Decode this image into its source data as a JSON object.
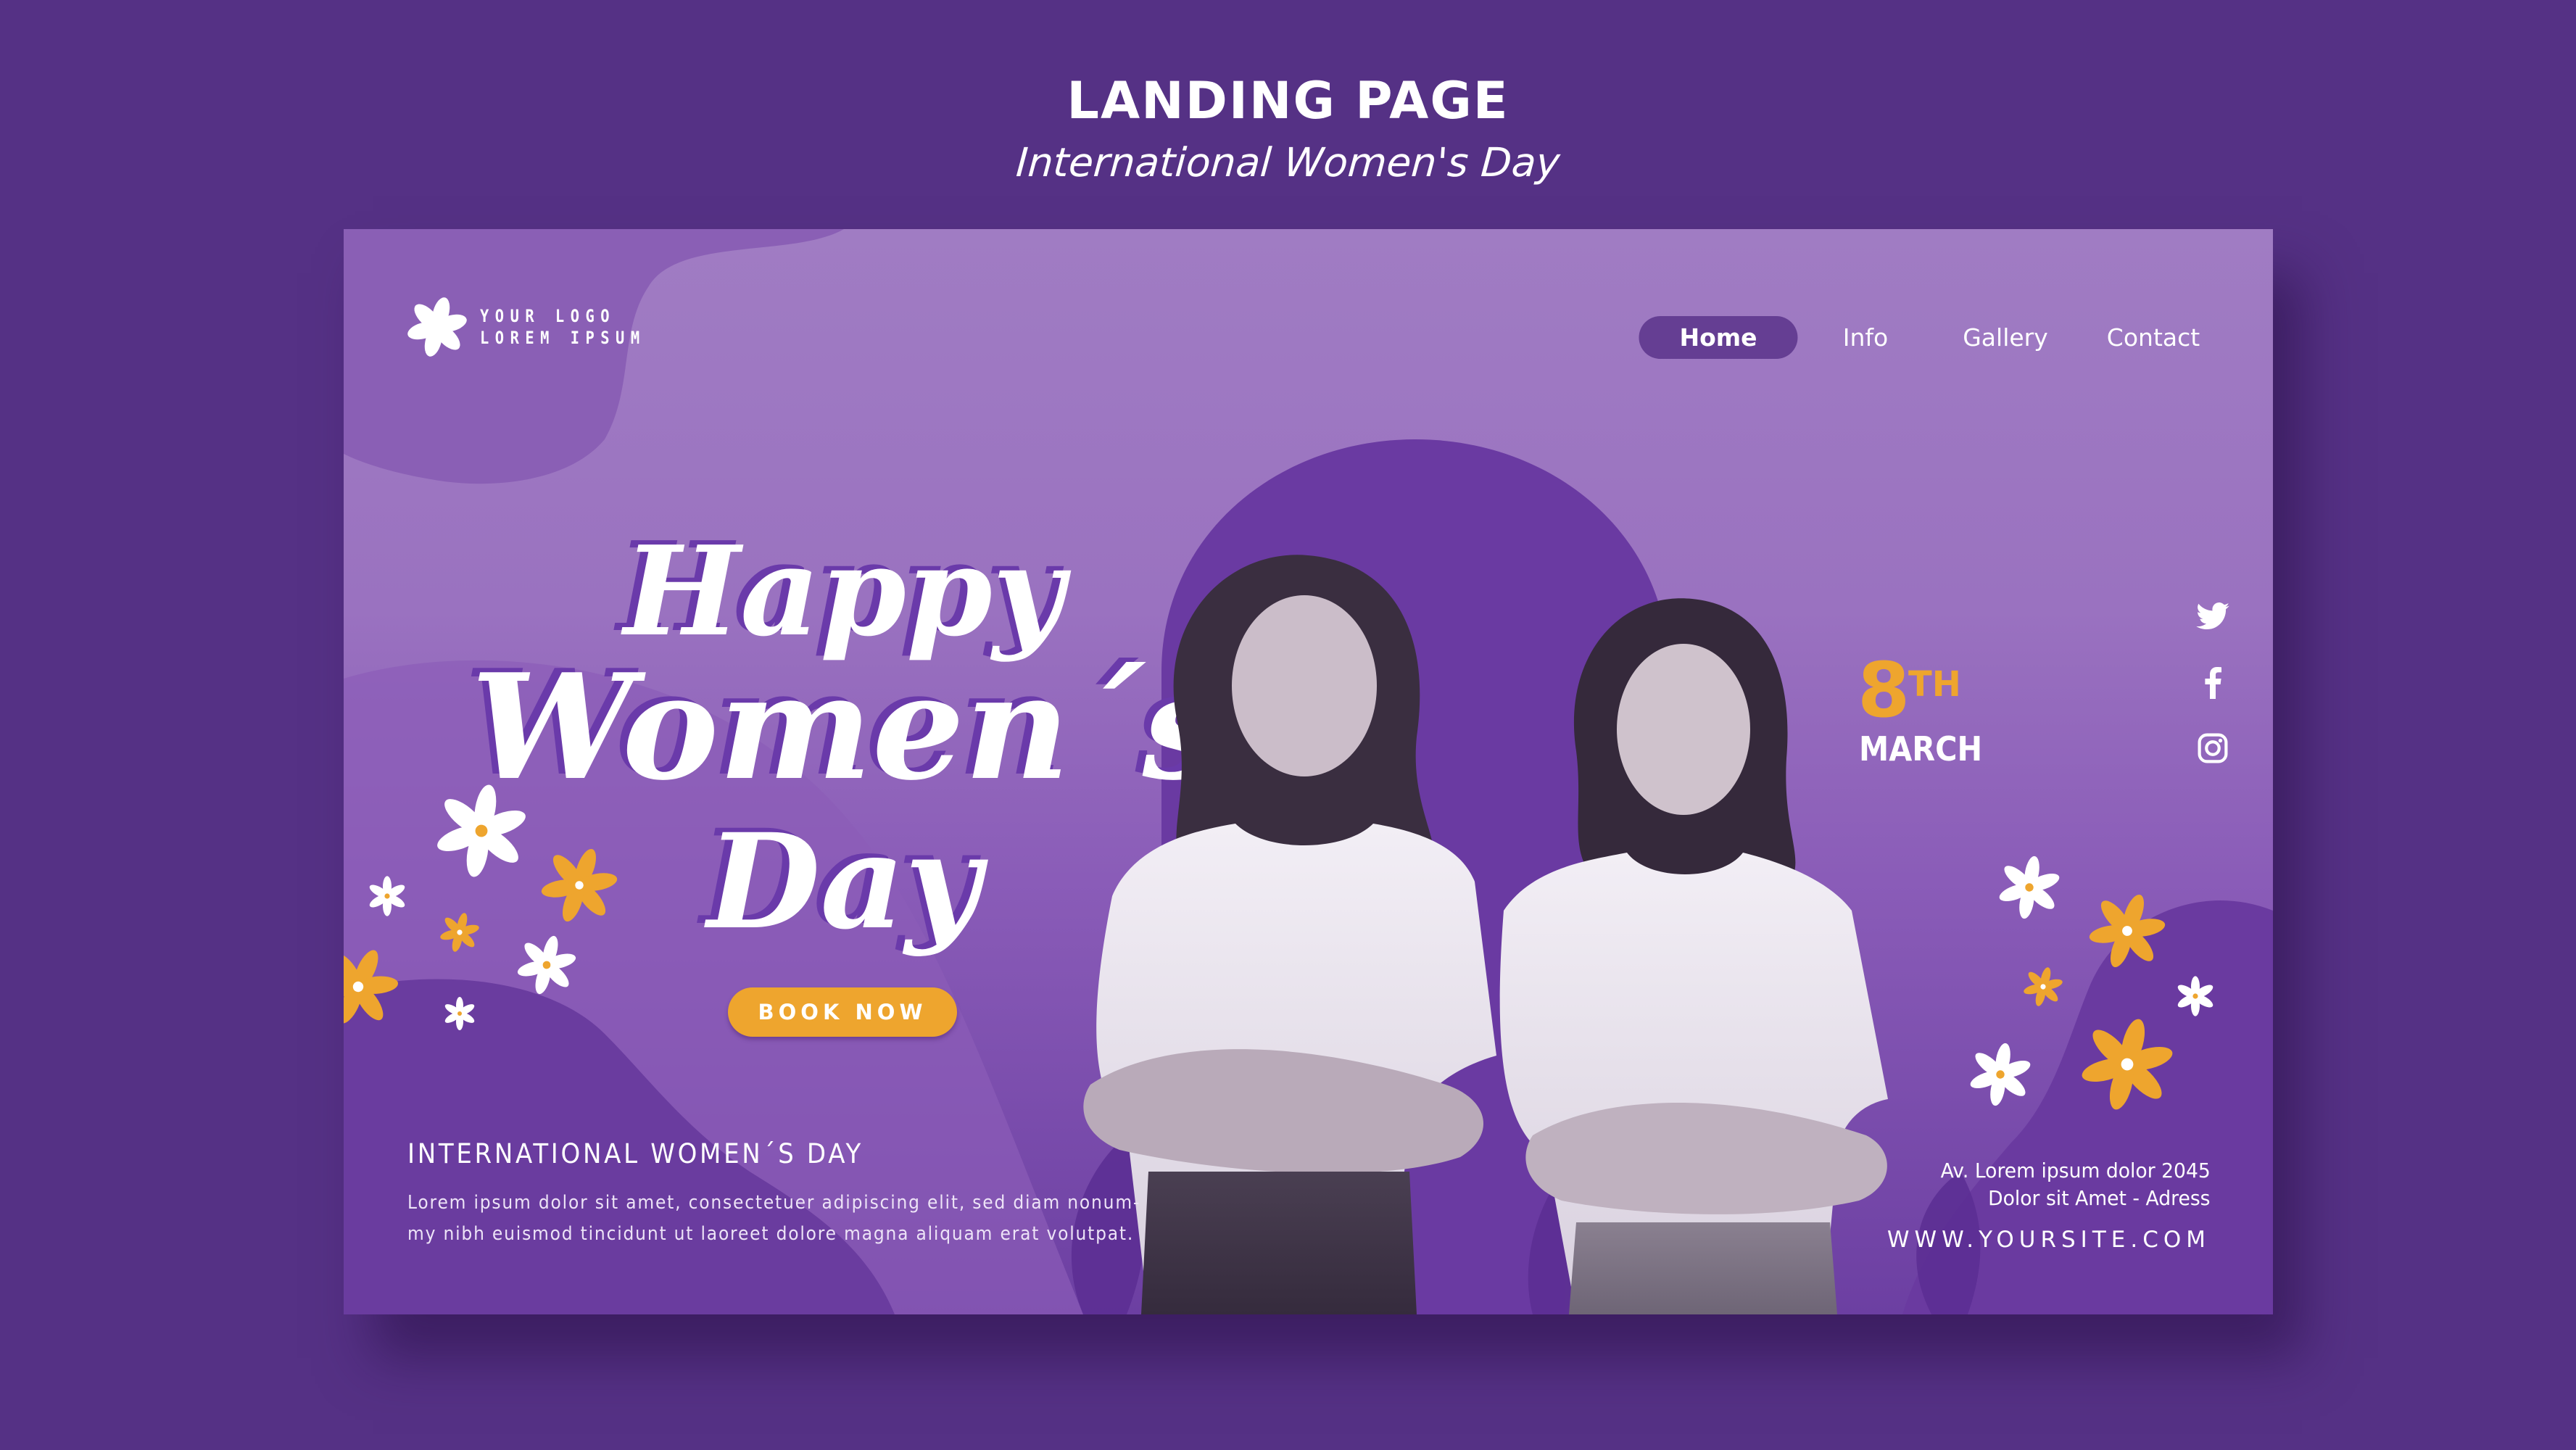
{
  "header": {
    "title": "LANDING PAGE",
    "subtitle": "International Women's Day"
  },
  "colors": {
    "page_background": "#553185",
    "card_top": "#a07cc3",
    "card_bottom": "#6c3fa2",
    "accent_orange": "#eea52e",
    "nav_active": "#653e93",
    "arch": "#6a3aa2"
  },
  "logo": {
    "icon": "flower-icon",
    "line1": "YOUR LOGO",
    "line2": "LOREM IPSUM"
  },
  "nav": {
    "items": [
      {
        "label": "Home",
        "active": true
      },
      {
        "label": "Info",
        "active": false
      },
      {
        "label": "Gallery",
        "active": false
      },
      {
        "label": "Contact",
        "active": false
      }
    ]
  },
  "hero": {
    "line1": "Happy",
    "line2": "Women´s",
    "line3": "Day",
    "cta_label": "BOOK NOW",
    "photo_alt": "Two smiling women in white t-shirts with crossed arms"
  },
  "date": {
    "day": "8",
    "suffix": "TH",
    "month": "MARCH"
  },
  "social": [
    {
      "name": "twitter",
      "icon": "twitter-icon"
    },
    {
      "name": "facebook",
      "icon": "facebook-icon"
    },
    {
      "name": "instagram",
      "icon": "instagram-icon"
    }
  ],
  "footer": {
    "heading": "INTERNATIONAL WOMEN´S DAY",
    "body_line1": "Lorem ipsum dolor sit amet, consectetuer adipiscing elit, sed diam nonum-",
    "body_line2": "my nibh euismod tincidunt ut laoreet dolore magna aliquam erat volutpat.",
    "address_line1": "Av. Lorem ipsum dolor 2045",
    "address_line2": "Dolor sit Amet - Adress",
    "website": "WWW.YOURSITE.COM"
  }
}
